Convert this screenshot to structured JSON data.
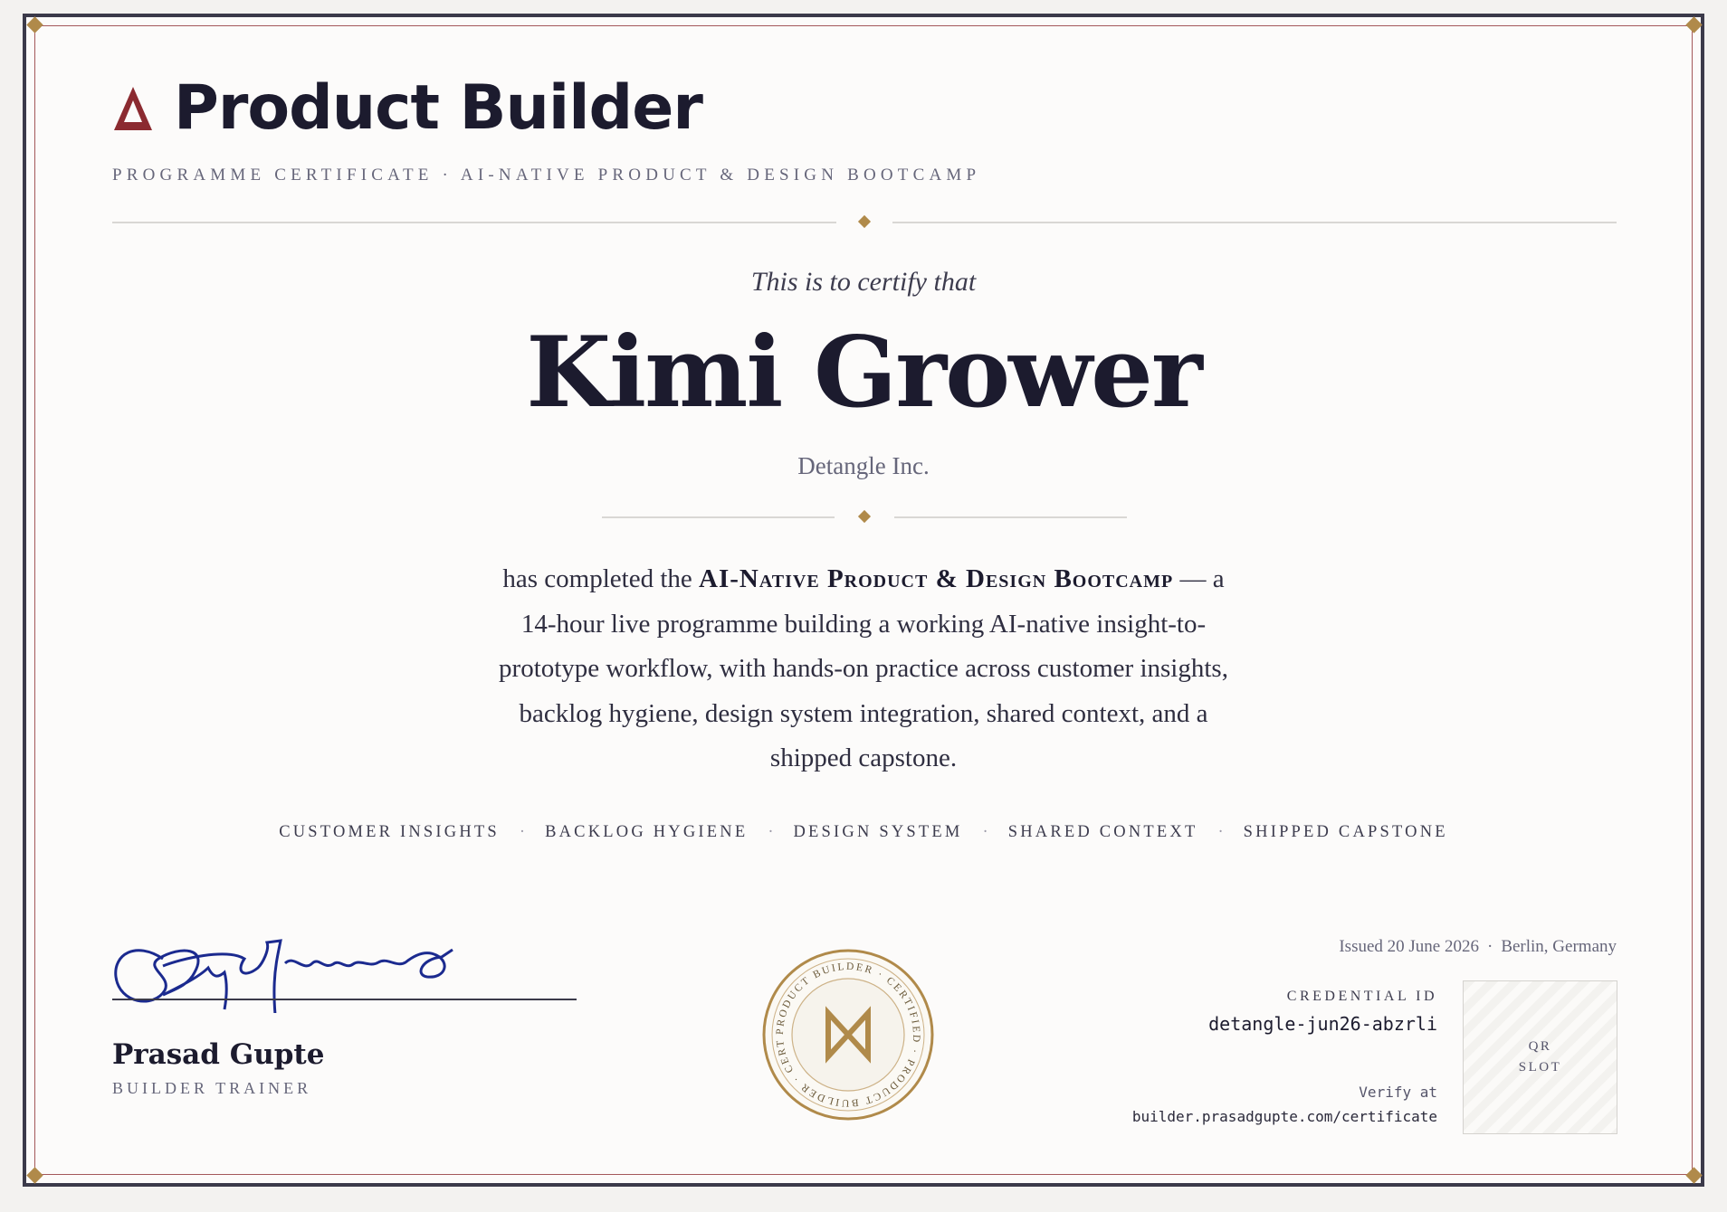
{
  "brand": {
    "name": "Product Builder",
    "mark_color": "#8b2a30"
  },
  "subtitle": "PROGRAMME CERTIFICATE · AI-NATIVE PRODUCT & DESIGN BOOTCAMP",
  "certify_text": "This is to certify that",
  "recipient": {
    "name": "Kimi Grower",
    "organization": "Detangle Inc."
  },
  "body": {
    "prefix": "has completed the ",
    "programme": "AI-Native Product & Design Bootcamp",
    "description": " — a 14-hour live programme building a working AI-native insight-to-prototype workflow, with hands-on practice across customer insights, backlog hygiene, design system integration, shared context, and a shipped capstone."
  },
  "skills": [
    "CUSTOMER INSIGHTS",
    "BACKLOG HYGIENE",
    "DESIGN SYSTEM",
    "SHARED CONTEXT",
    "SHIPPED CAPSTONE"
  ],
  "signatory": {
    "name": "Prasad Gupte",
    "role": "BUILDER TRAINER",
    "signature_lettering": "Prasad"
  },
  "seal": {
    "ring_text": "PRODUCT BUILDER · CERTIFIED · PRODUCT BUILDER · CERT · ",
    "color": "#b08a4a"
  },
  "issued": {
    "label": "Issued 20 June 2026",
    "location": "Berlin, Germany"
  },
  "credential": {
    "label": "CREDENTIAL ID",
    "id": "detangle-jun26-abzrli"
  },
  "verify": {
    "label": "Verify at",
    "url": "builder.prasadgupte.com/certificate"
  },
  "qr": {
    "line1": "QR",
    "line2": "SLOT"
  },
  "colors": {
    "accent_gold": "#b08a4a",
    "frame": "#3b3a4a",
    "inner_border": "#a4585a",
    "ink": "#1c1b2e"
  }
}
